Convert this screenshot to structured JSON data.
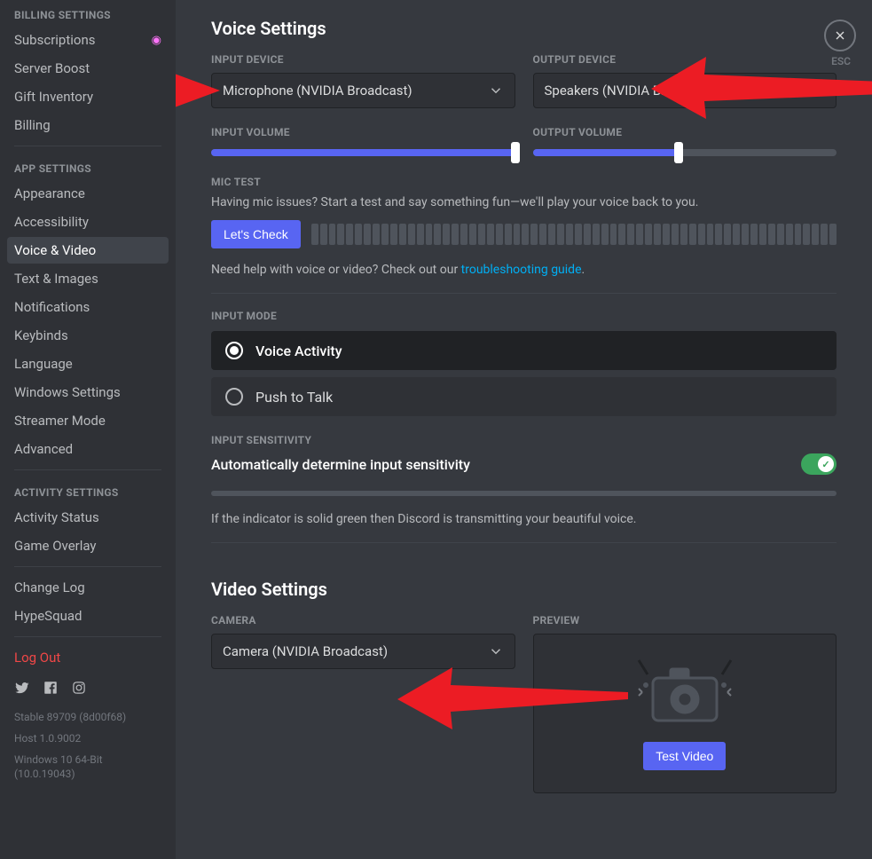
{
  "sidebar": {
    "billing_header": "BILLING SETTINGS",
    "billing_items": [
      "Subscriptions",
      "Server Boost",
      "Gift Inventory",
      "Billing"
    ],
    "app_header": "APP SETTINGS",
    "app_items": [
      "Appearance",
      "Accessibility",
      "Voice & Video",
      "Text & Images",
      "Notifications",
      "Keybinds",
      "Language",
      "Windows Settings",
      "Streamer Mode",
      "Advanced"
    ],
    "activity_header": "ACTIVITY SETTINGS",
    "activity_items": [
      "Activity Status",
      "Game Overlay"
    ],
    "misc_items": [
      "Change Log",
      "HypeSquad"
    ],
    "logout": "Log Out",
    "version": [
      "Stable 89709 (8d00f68)",
      "Host 1.0.9002",
      "Windows 10 64-Bit (10.0.19043)"
    ]
  },
  "close": {
    "esc": "ESC"
  },
  "voice": {
    "title": "Voice Settings",
    "input_device_label": "INPUT DEVICE",
    "input_device_value": "Microphone (NVIDIA Broadcast)",
    "output_device_label": "OUTPUT DEVICE",
    "output_device_value": "Speakers (NVIDIA Broadcast)",
    "input_volume_label": "INPUT VOLUME",
    "input_volume_pct": 100,
    "output_volume_label": "OUTPUT VOLUME",
    "output_volume_pct": 48,
    "mic_test_label": "MIC TEST",
    "mic_test_desc": "Having mic issues? Start a test and say something fun—we'll play your voice back to you.",
    "lets_check": "Let's Check",
    "help_prefix": "Need help with voice or video? Check out our ",
    "help_link": "troubleshooting guide",
    "help_suffix": ".",
    "input_mode_label": "INPUT MODE",
    "mode_voice_activity": "Voice Activity",
    "mode_ptt": "Push to Talk",
    "input_sensitivity_label": "INPUT SENSITIVITY",
    "auto_sensitivity": "Automatically determine input sensitivity",
    "sensitivity_note": "If the indicator is solid green then Discord is transmitting your beautiful voice."
  },
  "video": {
    "title": "Video Settings",
    "camera_label": "CAMERA",
    "camera_value": "Camera (NVIDIA Broadcast)",
    "preview_label": "PREVIEW",
    "test_video": "Test Video"
  }
}
